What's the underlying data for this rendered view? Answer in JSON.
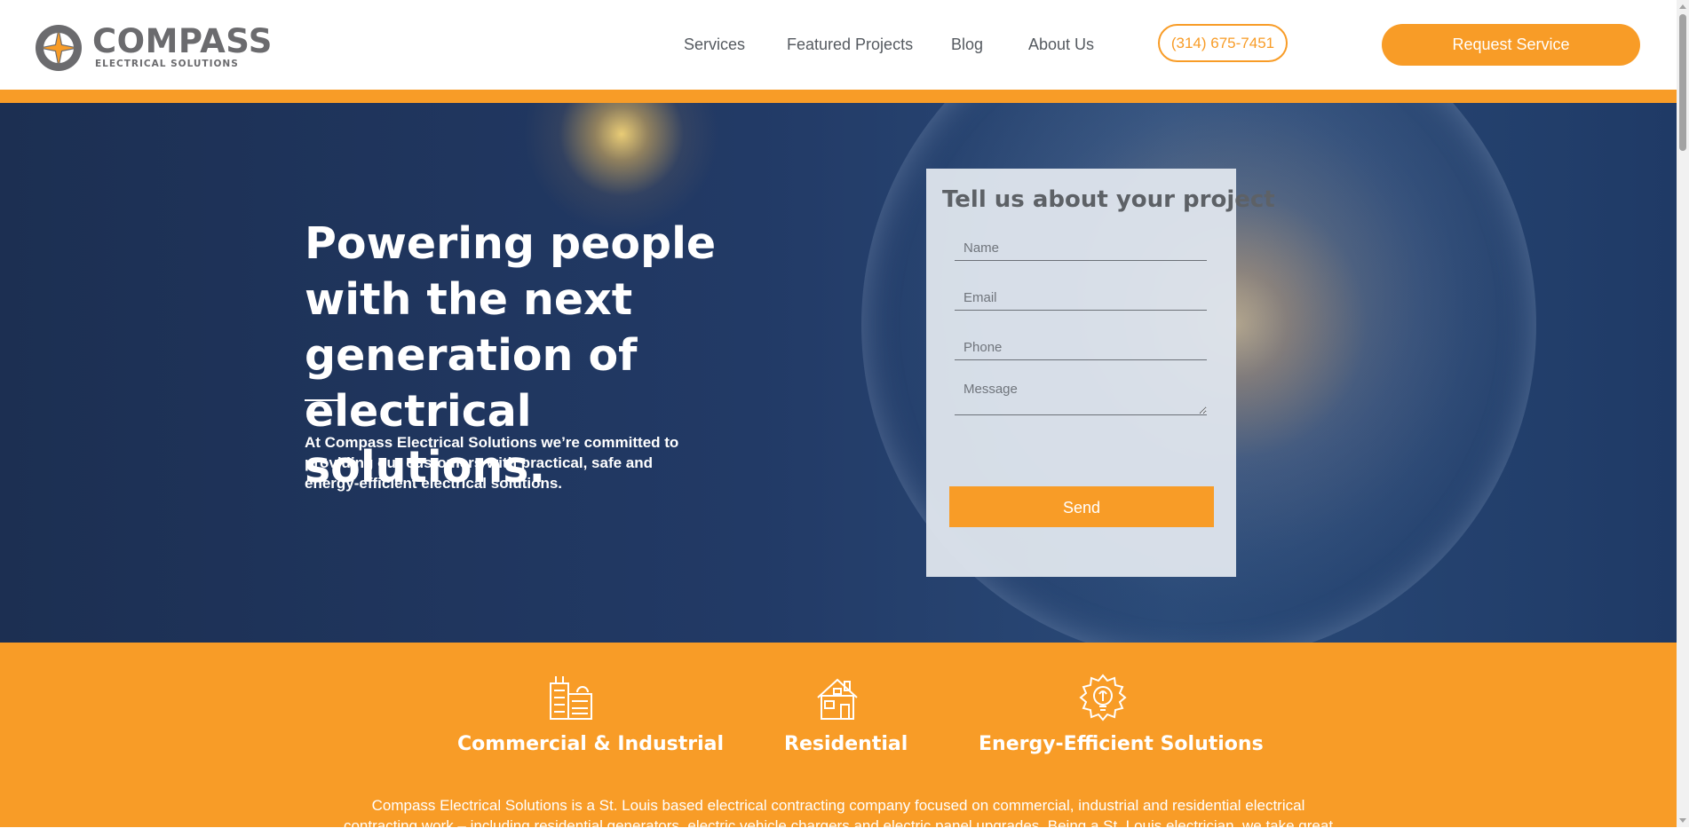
{
  "brand": {
    "name": "COMPASS",
    "tagline": "ELECTRICAL SOLUTIONS"
  },
  "nav": {
    "items": [
      {
        "label": "Services"
      },
      {
        "label": "Featured Projects"
      },
      {
        "label": "Blog"
      },
      {
        "label": "About Us"
      }
    ],
    "phone": "(314) 675-7451",
    "cta": "Request Service"
  },
  "hero": {
    "title": "Powering people with the next generation of electrical solutions.",
    "text": "At Compass Electrical Solutions we’re committed to providing our customers with practical, safe and energy-efficient electrical solutions."
  },
  "form": {
    "title": "Tell us about your project",
    "name_placeholder": "Name",
    "email_placeholder": "Email",
    "phone_placeholder": "Phone",
    "message_placeholder": "Message",
    "submit": "Send"
  },
  "services": {
    "items": [
      {
        "label": "Commercial & Industrial",
        "icon": "building-icon"
      },
      {
        "label": "Residential",
        "icon": "house-icon"
      },
      {
        "label": "Energy-Efficient Solutions",
        "icon": "eco-bulb-icon"
      }
    ],
    "description": "Compass Electrical Solutions is a St. Louis based electrical contracting company focused on commercial, industrial and residential electrical contracting work – including residential generators, electric vehicle chargers and electric panel upgrades. Being a St. Louis electrician, we take great"
  },
  "colors": {
    "accent": "#f89c27",
    "hero_bg": "#1f3760",
    "text_gray": "#555a60"
  }
}
